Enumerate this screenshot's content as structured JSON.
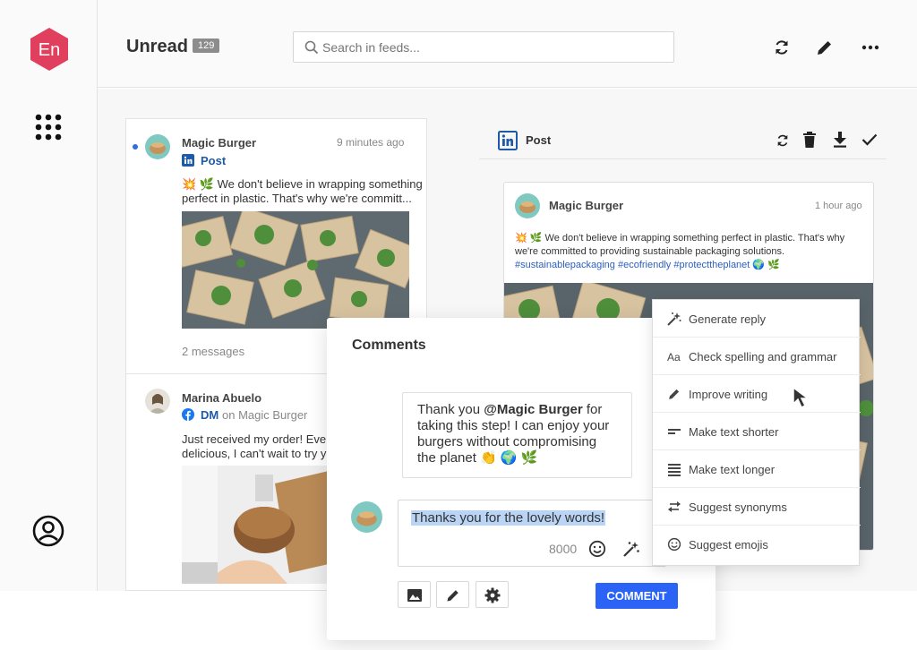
{
  "header": {
    "title": "Unread",
    "count": "129",
    "search_placeholder": "Search in feeds..."
  },
  "feed": {
    "items": [
      {
        "author": "Magic Burger",
        "time": "9 minutes ago",
        "channel": "Post",
        "text_line1": "💥 🌿 We don't believe in wrapping something",
        "text_line2": "perfect in plastic. That's why we're committ...",
        "footer": "2 messages"
      },
      {
        "author": "Marina Abuelo",
        "channel": "DM",
        "channel_suffix": "on Magic Burger",
        "text_line1": "Just received my order! Every",
        "text_line2": "delicious, I can't wait to try yo"
      }
    ]
  },
  "detail": {
    "channel": "Post",
    "post": {
      "author": "Magic Burger",
      "time": "1 hour ago",
      "text": "💥 🌿 We don't believe in wrapping something perfect in plastic. That's why we're committed to providing sustainable packaging solutions.",
      "hashtags": "#sustainablepackaging #ecofriendly #protecttheplanet",
      "tail": " 🌍 🌿"
    }
  },
  "comments": {
    "title": "Comments",
    "quote_pre": "Thank you ",
    "quote_mention": "@Magic Burger",
    "quote_post": " for taking this step! I can enjoy your burgers without compromising the planet 👏 🌍 🌿",
    "draft": "Thanks you for the lovely words!",
    "char_count": "8000",
    "submit_label": "COMMENT"
  },
  "ai_menu": [
    {
      "label": "Generate reply",
      "icon": "magic-wand-icon"
    },
    {
      "label": "Check spelling and grammar",
      "icon": "text-aa-icon"
    },
    {
      "label": "Improve writing",
      "icon": "pencil-icon"
    },
    {
      "label": "Make text shorter",
      "icon": "short-lines-icon"
    },
    {
      "label": "Make text longer",
      "icon": "long-lines-icon"
    },
    {
      "label": "Suggest synonyms",
      "icon": "swap-arrows-icon"
    },
    {
      "label": "Suggest emojis",
      "icon": "smiley-icon"
    }
  ],
  "colors": {
    "brand": "#e0405e",
    "accent": "#2a63f6",
    "linkedin": "#1d5aa7",
    "facebook": "#1877f2"
  },
  "logo_text": "En"
}
